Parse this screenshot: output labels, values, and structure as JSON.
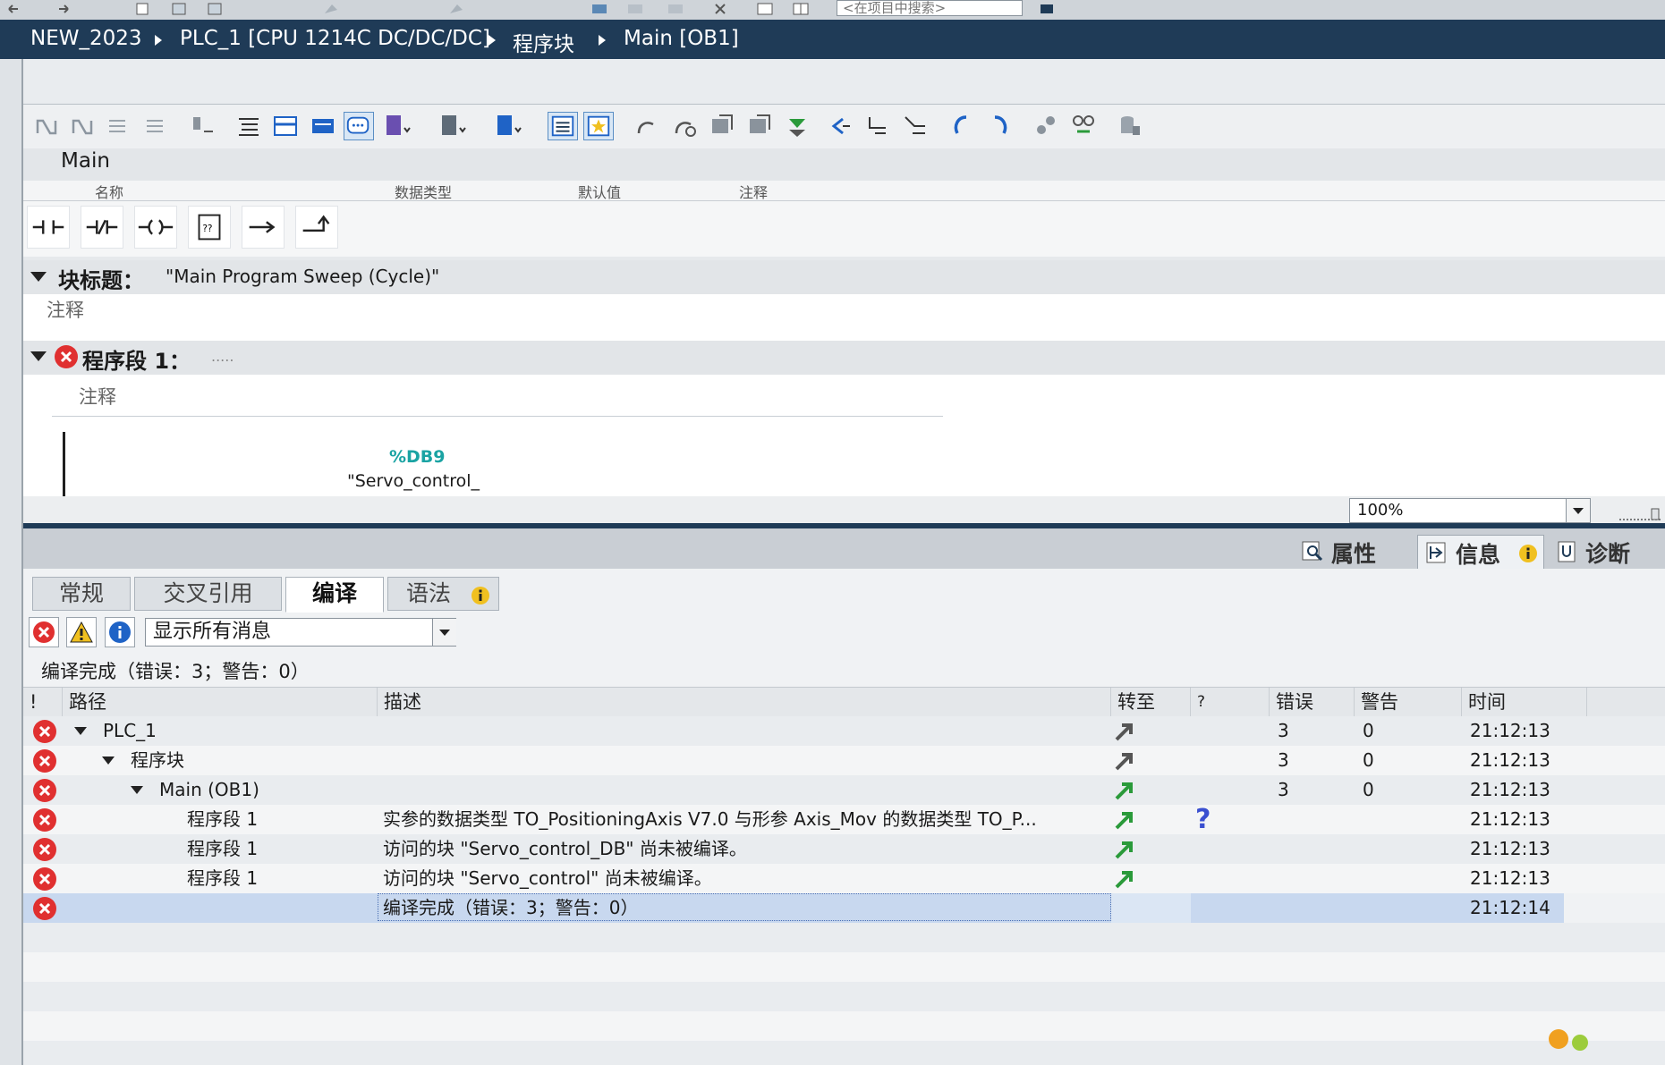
{
  "topbar": {
    "search_placeholder": "<在项目中搜索>"
  },
  "breadcrumb": [
    "NEW_2023",
    "PLC_1 [CPU 1214C DC/DC/DC]",
    "程序块",
    "Main [OB1]"
  ],
  "editor": {
    "block_name": "Main",
    "interface_columns": [
      "名称",
      "数据类型",
      "默认值",
      "注释"
    ],
    "block_title_label": "块标题：",
    "block_title_value": "\"Main Program Sweep (Cycle)\"",
    "block_comment": "注释",
    "network_label": "程序段 1：",
    "network_title": ".....",
    "network_comment": "注释",
    "db_address": "%DB9",
    "db_name": "\"Servo_control_",
    "zoom": "100%"
  },
  "inspector_tabs": [
    {
      "label": "属性",
      "icon": "magnifier-icon"
    },
    {
      "label": "信息",
      "icon": "info-icon"
    },
    {
      "label": "诊断",
      "icon": "diagnostics-icon"
    }
  ],
  "sub_tabs": [
    "常规",
    "交叉引用",
    "编译",
    "语法"
  ],
  "filter": {
    "selected": "显示所有消息"
  },
  "summary": "编译完成（错误：3；警告：0）",
  "columns": {
    "flag": "!",
    "path": "路径",
    "desc": "描述",
    "goto": "转至",
    "help": "?",
    "errors": "错误",
    "warnings": "警告",
    "time": "时间"
  },
  "messages": [
    {
      "path": "PLC_1",
      "desc": "",
      "errors": "3",
      "warnings": "0",
      "time": "21:12:13"
    },
    {
      "path": "程序块",
      "desc": "",
      "errors": "3",
      "warnings": "0",
      "time": "21:12:13"
    },
    {
      "path": "Main (OB1)",
      "desc": "",
      "errors": "3",
      "warnings": "0",
      "time": "21:12:13"
    },
    {
      "path": "程序段 1",
      "desc": "实参的数据类型 TO_PositioningAxis V7.0 与形参 Axis_Mov 的数据类型 TO_P...",
      "help": "?",
      "errors": "",
      "warnings": "",
      "time": "21:12:13"
    },
    {
      "path": "程序段 1",
      "desc": "访问的块 \"Servo_control_DB\" 尚未被编译。",
      "errors": "",
      "warnings": "",
      "time": "21:12:13"
    },
    {
      "path": "程序段 1",
      "desc": "访问的块 \"Servo_control\" 尚未被编译。",
      "errors": "",
      "warnings": "",
      "time": "21:12:13"
    },
    {
      "path": "",
      "desc": "编译完成（错误：3；警告：0）",
      "errors": "",
      "warnings": "",
      "time": "21:12:14"
    }
  ],
  "colors": {
    "accent": "#1f3b57",
    "error": "#e03030",
    "teal": "#1aa3a3",
    "selection": "#c8d8ef"
  }
}
